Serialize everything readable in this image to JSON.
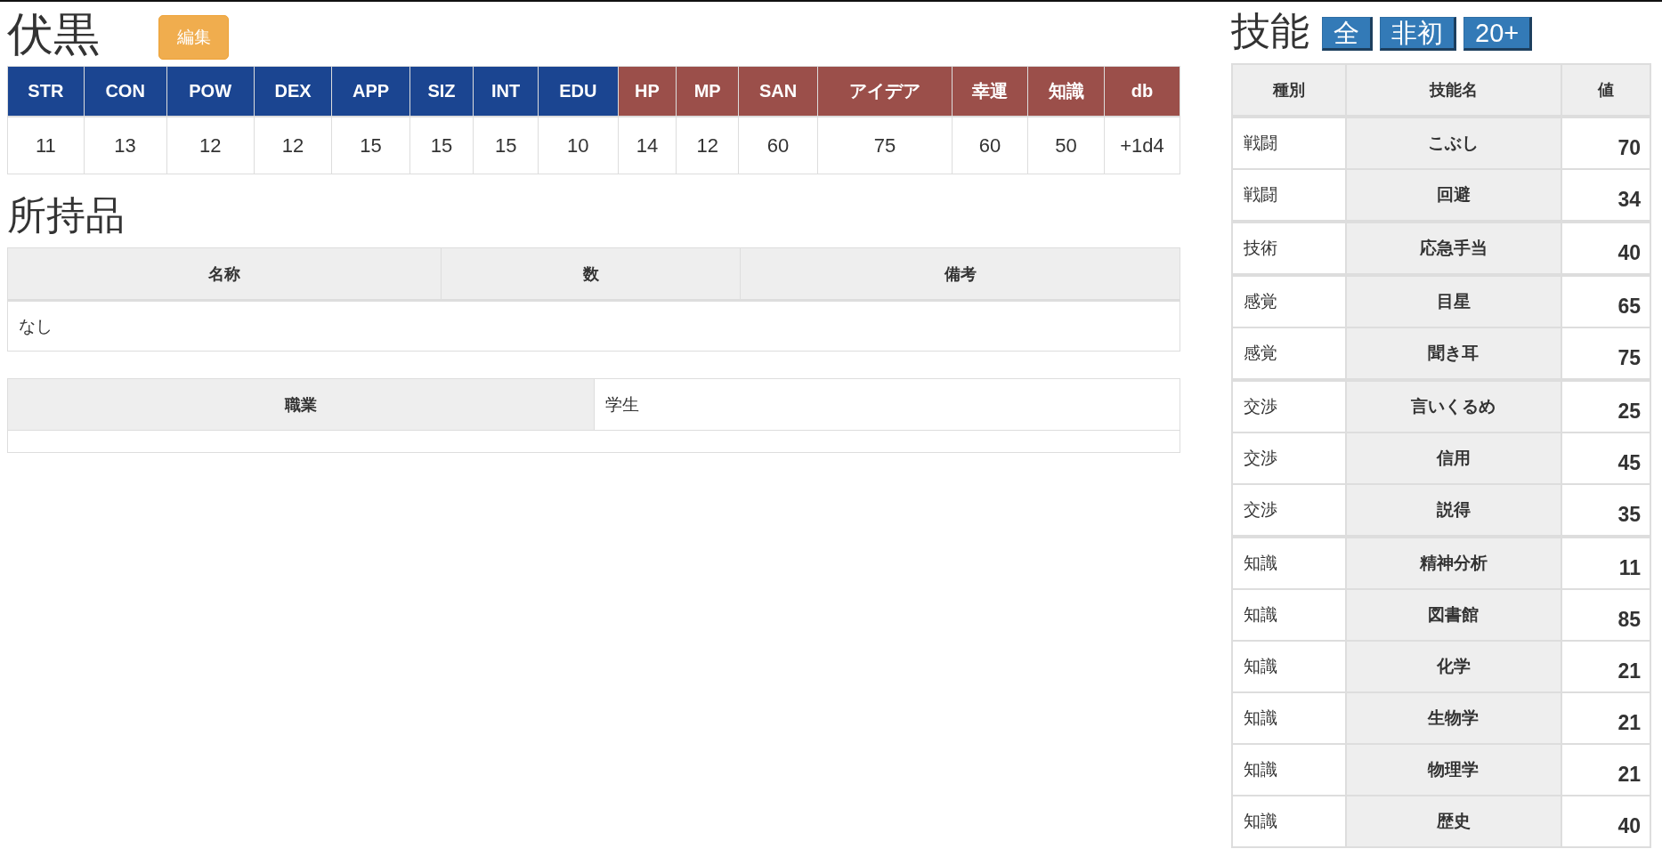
{
  "title": "伏黒",
  "edit_button": "編集",
  "stats": [
    {
      "label": "STR",
      "value": "11",
      "kind": "ability"
    },
    {
      "label": "CON",
      "value": "13",
      "kind": "ability"
    },
    {
      "label": "POW",
      "value": "12",
      "kind": "ability"
    },
    {
      "label": "DEX",
      "value": "12",
      "kind": "ability"
    },
    {
      "label": "APP",
      "value": "15",
      "kind": "ability"
    },
    {
      "label": "SIZ",
      "value": "15",
      "kind": "ability"
    },
    {
      "label": "INT",
      "value": "15",
      "kind": "ability"
    },
    {
      "label": "EDU",
      "value": "10",
      "kind": "ability"
    },
    {
      "label": "HP",
      "value": "14",
      "kind": "derived"
    },
    {
      "label": "MP",
      "value": "12",
      "kind": "derived"
    },
    {
      "label": "SAN",
      "value": "60",
      "kind": "derived"
    },
    {
      "label": "アイデア",
      "value": "75",
      "kind": "derived"
    },
    {
      "label": "幸運",
      "value": "60",
      "kind": "derived"
    },
    {
      "label": "知識",
      "value": "50",
      "kind": "derived"
    },
    {
      "label": "db",
      "value": "+1d4",
      "kind": "derived"
    }
  ],
  "inventory": {
    "heading": "所持品",
    "columns": [
      "名称",
      "数",
      "備考"
    ],
    "empty_message": "なし"
  },
  "profile": {
    "label": "職業",
    "value": "学生"
  },
  "skills": {
    "heading": "技能",
    "filters": [
      "全",
      "非初",
      "20+"
    ],
    "columns": [
      "種別",
      "技能名",
      "値"
    ],
    "rows": [
      {
        "category": "戦闘",
        "name": "こぶし",
        "value": "70"
      },
      {
        "category": "戦闘",
        "name": "回避",
        "value": "34"
      },
      {
        "category": "技術",
        "name": "応急手当",
        "value": "40"
      },
      {
        "category": "感覚",
        "name": "目星",
        "value": "65"
      },
      {
        "category": "感覚",
        "name": "聞き耳",
        "value": "75"
      },
      {
        "category": "交渉",
        "name": "言いくるめ",
        "value": "25"
      },
      {
        "category": "交渉",
        "name": "信用",
        "value": "45"
      },
      {
        "category": "交渉",
        "name": "説得",
        "value": "35"
      },
      {
        "category": "知識",
        "name": "精神分析",
        "value": "11"
      },
      {
        "category": "知識",
        "name": "図書館",
        "value": "85"
      },
      {
        "category": "知識",
        "name": "化学",
        "value": "21"
      },
      {
        "category": "知識",
        "name": "生物学",
        "value": "21"
      },
      {
        "category": "知識",
        "name": "物理学",
        "value": "21"
      },
      {
        "category": "知識",
        "name": "歴史",
        "value": "40"
      }
    ]
  }
}
